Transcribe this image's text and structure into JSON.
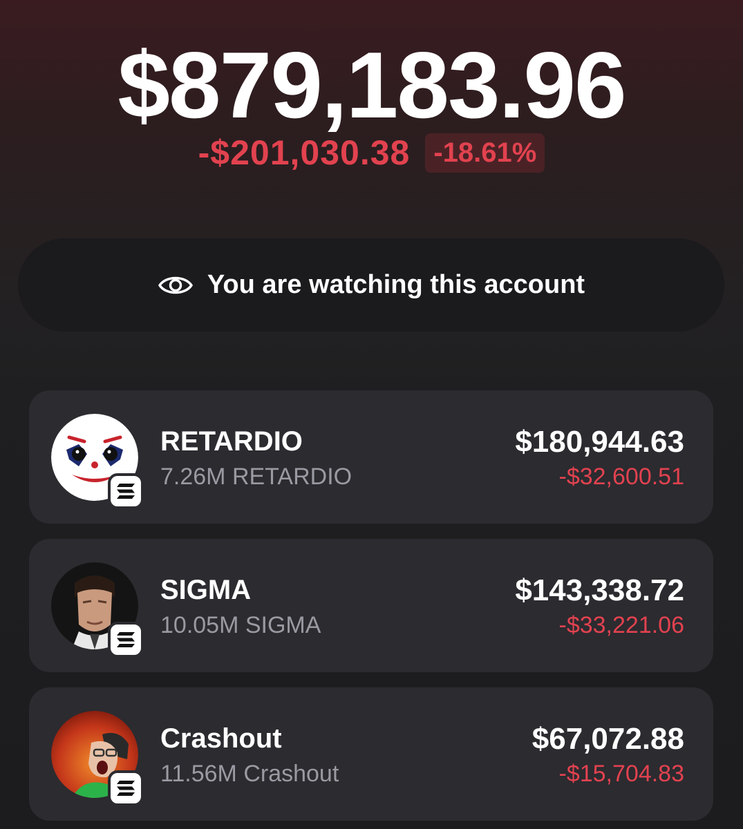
{
  "portfolio": {
    "balance": "$879,183.96",
    "change_amount": "-$201,030.38",
    "change_percent": "-18.61%"
  },
  "watch_banner": {
    "icon": "eye-icon",
    "text": "You are watching this account"
  },
  "colors": {
    "negative": "#e2424f",
    "card_background": "#2b2b30",
    "muted_text": "#9a9aa2"
  },
  "assets": [
    {
      "name": "RETARDIO",
      "amount": "7.26M RETARDIO",
      "value": "$180,944.63",
      "change": "-$32,600.51",
      "avatar": "clown-face-avatar",
      "chain_icon": "solana-icon"
    },
    {
      "name": "SIGMA",
      "amount": "10.05M SIGMA",
      "value": "$143,338.72",
      "change": "-$33,221.06",
      "avatar": "man-portrait-avatar",
      "chain_icon": "solana-icon"
    },
    {
      "name": "Crashout",
      "amount": "11.56M Crashout",
      "value": "$67,072.88",
      "change": "-$15,704.83",
      "avatar": "screaming-person-avatar",
      "chain_icon": "solana-icon"
    }
  ]
}
